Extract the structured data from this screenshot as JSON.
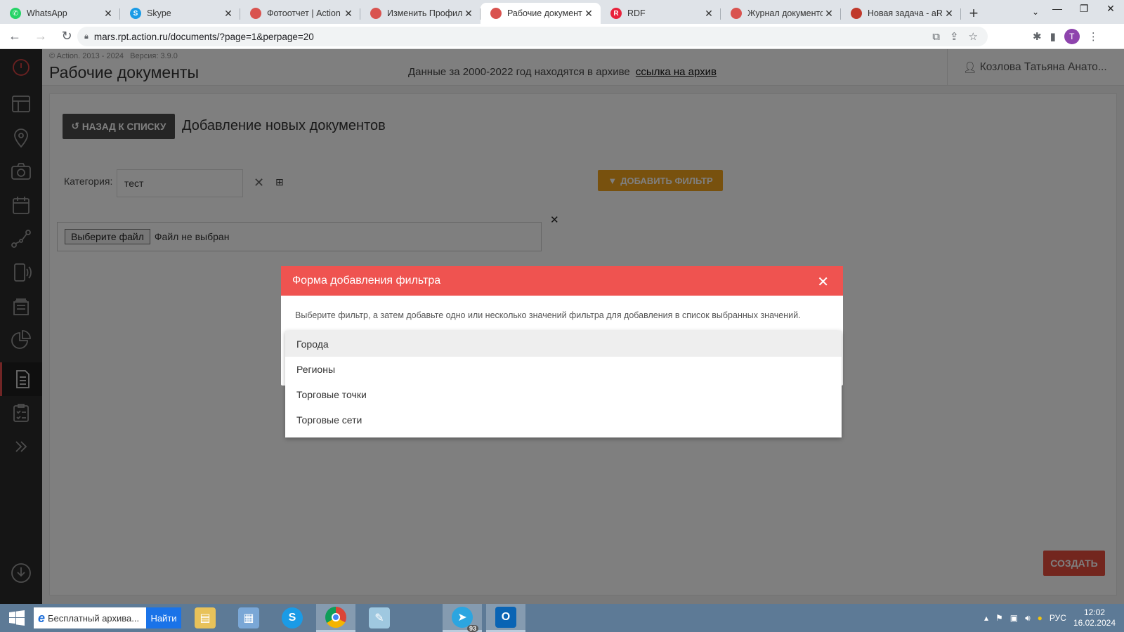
{
  "browser": {
    "tabs": [
      {
        "title": "WhatsApp",
        "icon": "whatsapp-icon",
        "color": "#25d366",
        "glyph": "✆"
      },
      {
        "title": "Skype",
        "icon": "skype-icon",
        "color": "#1a9be6",
        "glyph": "S"
      },
      {
        "title": "Фотоотчет | Action D",
        "icon": "action-icon",
        "color": "#d9534f",
        "glyph": ""
      },
      {
        "title": "Изменить Профиль",
        "icon": "action-icon",
        "color": "#d9534f",
        "glyph": ""
      },
      {
        "title": "Рабочие документы",
        "icon": "action-icon",
        "color": "#d9534f",
        "glyph": "",
        "active": true
      },
      {
        "title": "RDF",
        "icon": "rdf-icon",
        "color": "#e8223b",
        "glyph": "R"
      },
      {
        "title": "Журнал документов",
        "icon": "action-icon",
        "color": "#d9534f",
        "glyph": ""
      },
      {
        "title": "Новая задача - aRe",
        "icon": "arc-icon",
        "color": "#c0392b",
        "glyph": ""
      }
    ],
    "url": "mars.rpt.action.ru/documents/?page=1&perpage=20",
    "profile_initial": "T"
  },
  "header": {
    "copyright": "© Action. 2013 - 2024",
    "version": "Версия: 3.9.0",
    "title": "Рабочие документы",
    "archive_text": "Данные за 2000-2022 год находятся в архиве",
    "archive_link": "ссылка на архив",
    "user": "Козлова Татьяна Анато..."
  },
  "form": {
    "back_label": "НАЗАД К СПИСКУ",
    "title": "Добавление новых документов",
    "category_label": "Категория:",
    "category_value": "тест",
    "add_filter_label": "ДОБАВИТЬ ФИЛЬТР",
    "file_button": "Выберите файл",
    "file_status": "Файл не выбран",
    "create_label": "СОЗДАТЬ"
  },
  "modal": {
    "title": "Форма добавления фильтра",
    "description": "Выберите фильтр, а затем добавьте одно или несколько значений фильтра для добавления в список выбранных значений.",
    "options": [
      "Города",
      "Регионы",
      "Торговые точки",
      "Торговые сети"
    ]
  },
  "taskbar": {
    "search_text": "Бесплатный архива...",
    "find_label": "Найти",
    "telegram_badge": "93",
    "lang": "РУС",
    "time": "12:02",
    "date": "16.02.2024"
  },
  "colors": {
    "accent_red": "#ef5350",
    "filter_orange": "#f0a21c",
    "nav_dark": "#2b2b2b"
  }
}
